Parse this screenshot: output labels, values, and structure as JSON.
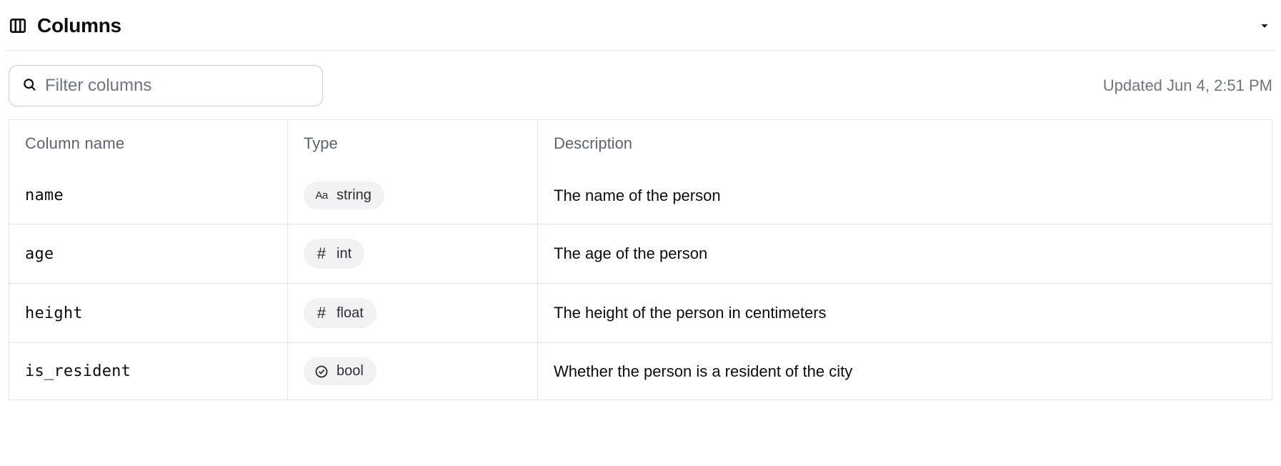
{
  "section": {
    "title": "Columns"
  },
  "filter": {
    "placeholder": "Filter columns"
  },
  "updated": "Updated Jun 4, 2:51 PM",
  "table": {
    "headers": {
      "name": "Column name",
      "type": "Type",
      "description": "Description"
    },
    "rows": [
      {
        "name": "name",
        "type_icon": "text",
        "type_label": "string",
        "description": "The name of the person"
      },
      {
        "name": "age",
        "type_icon": "number",
        "type_label": "int",
        "description": "The age of the person"
      },
      {
        "name": "height",
        "type_icon": "number",
        "type_label": "float",
        "description": "The height of the person in centimeters"
      },
      {
        "name": "is_resident",
        "type_icon": "bool",
        "type_label": "bool",
        "description": "Whether the person is a resident of the city"
      }
    ]
  }
}
